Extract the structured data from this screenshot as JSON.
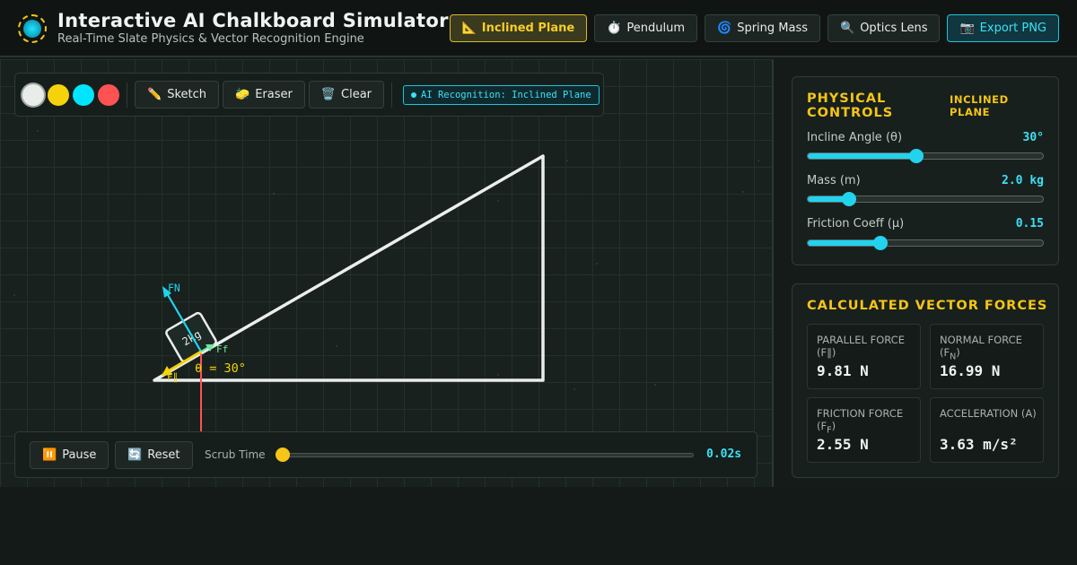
{
  "header": {
    "title": "Interactive AI Chalkboard Simulator",
    "subtitle": "Real-Time Slate Physics & Vector Recognition Engine",
    "nav": [
      {
        "icon": "📐",
        "label": "Inclined Plane",
        "active": true
      },
      {
        "icon": "⏱️",
        "label": "Pendulum"
      },
      {
        "icon": "🌀",
        "label": "Spring Mass"
      },
      {
        "icon": "🔍",
        "label": "Optics Lens"
      },
      {
        "icon": "📷",
        "label": "Export PNG"
      }
    ]
  },
  "toolbar": {
    "colors": [
      "#e9ede9",
      "#f5d20a",
      "#00e5ff",
      "#ff5252"
    ],
    "sketch": {
      "icon": "✏️",
      "label": "Sketch"
    },
    "eraser": {
      "icon": "🧽",
      "label": "Eraser"
    },
    "clear": {
      "icon": "🗑️",
      "label": "Clear"
    },
    "ai_badge": "AI Recognition: Inclined Plane"
  },
  "canvas": {
    "block_label": "2kg",
    "angle_label": "θ = 30°",
    "fn_label": "FN",
    "ff_label": "Ff",
    "fpar_label": "F∥"
  },
  "playback": {
    "pause": {
      "icon": "⏸️",
      "label": "Pause"
    },
    "reset": {
      "icon": "🔄",
      "label": "Reset"
    },
    "scrub_label": "Scrub Time",
    "scrub_value": "0.02s",
    "scrub_fraction": 0.0
  },
  "controls": {
    "title": "PHYSICAL CONTROLS",
    "tag": "INCLINED PLANE",
    "angle": {
      "label": "Incline Angle (θ)",
      "value": "30°",
      "fraction": 0.46
    },
    "mass": {
      "label": "Mass (m)",
      "value": "2.0 kg",
      "fraction": 0.175
    },
    "friction": {
      "label": "Friction Coeff (μ)",
      "value": "0.15",
      "fraction": 0.31
    }
  },
  "forces": {
    "title": "CALCULATED VECTOR FORCES",
    "parallel": {
      "label": "PARALLEL FORCE",
      "symbol": "(F∥)",
      "value": "9.81 N"
    },
    "normal": {
      "label": "NORMAL FORCE",
      "symbol_main": "(F",
      "symbol_sub": "N",
      "value": "16.99 N"
    },
    "friction": {
      "label": "FRICTION FORCE",
      "symbol_main": "(F",
      "symbol_sub": "F",
      "value": "2.55 N"
    },
    "acceleration": {
      "label": "ACCELERATION",
      "symbol": "(A)",
      "value": "3.63 m/s²"
    }
  }
}
